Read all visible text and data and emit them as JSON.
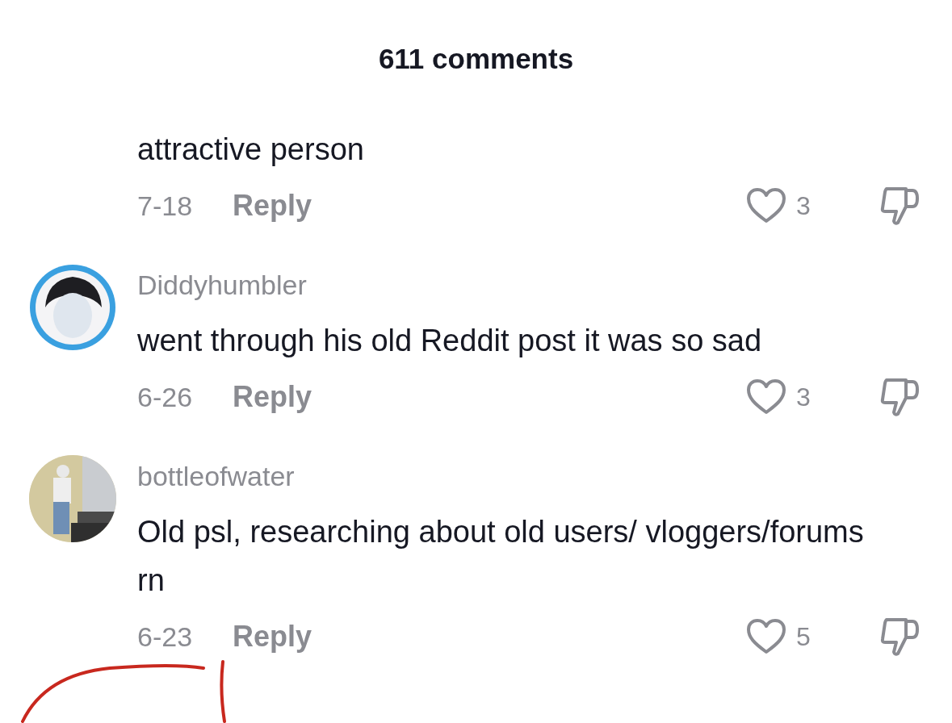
{
  "header": {
    "title": "611 comments"
  },
  "comments": [
    {
      "text": "attractive person",
      "date": "7-18",
      "reply": "Reply",
      "likes": "3"
    },
    {
      "avatar": {
        "kind": "cartoon"
      },
      "username": "Diddyhumbler",
      "text": "went through his old Reddit post it was so sad",
      "date": "6-26",
      "reply": "Reply",
      "likes": "3"
    },
    {
      "username": "bottleofwater",
      "text": "Old psl, researching about old users/ vloggers/forums rn",
      "date": "6-23",
      "reply": "Reply",
      "likes": "5"
    }
  ]
}
